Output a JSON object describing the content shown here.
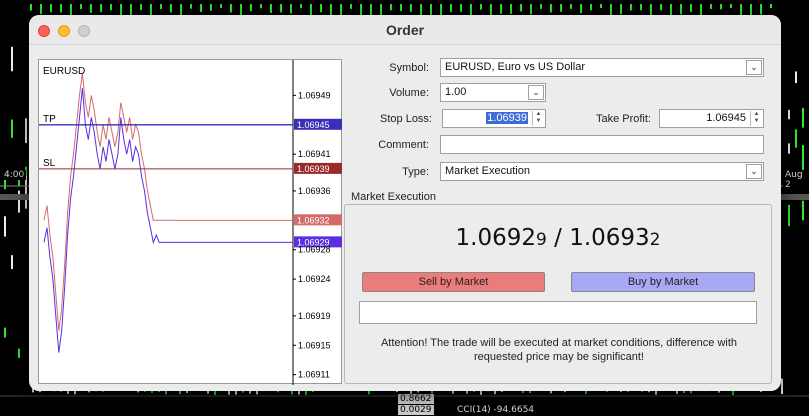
{
  "window": {
    "title": "Order"
  },
  "background": {
    "time_left": "4:00",
    "time_right": "Aug 2",
    "value_1": "0.8662",
    "value_2": "0.0029",
    "indicator": "CCI(14) -94.6654"
  },
  "chart": {
    "symbol": "EURUSD",
    "tp_label": "TP",
    "sl_label": "SL",
    "axis_labels": [
      "1.06949",
      "1.06945",
      "1.06941",
      "1.06939",
      "1.06936",
      "1.06932",
      "1.06929",
      "1.06928",
      "1.06924",
      "1.06919",
      "1.06915",
      "1.06911"
    ],
    "tp_price": "1.06945",
    "sl_price": "1.06939",
    "ask_price": "1.06932",
    "bid_price": "1.06929"
  },
  "chart_data": {
    "type": "line",
    "title": "EURUSD",
    "ylim": [
      1.0691,
      1.06953
    ],
    "series": [
      {
        "values": [
          1.06929,
          1.06931,
          1.06927,
          1.06924,
          1.06919,
          1.06914,
          1.06917,
          1.06923,
          1.0693,
          1.06935,
          1.06938,
          1.06942,
          1.06946,
          1.0695,
          1.06945,
          1.06943,
          1.06946,
          1.06944,
          1.06941,
          1.06939,
          1.06942,
          1.0694,
          1.06943,
          1.06941,
          1.06939,
          1.06941,
          1.06946,
          1.06943,
          1.06941,
          1.06943,
          1.0694,
          1.06942,
          1.06941,
          1.06938,
          1.06936,
          1.06933,
          1.06931,
          1.06929,
          1.0693,
          1.06929,
          1.06929,
          1.06929,
          1.06929,
          1.06929,
          1.06929
        ]
      },
      {
        "values": [
          1.06932,
          1.06934,
          1.0693,
          1.06927,
          1.06922,
          1.06917,
          1.0692,
          1.06926,
          1.06933,
          1.06938,
          1.06941,
          1.06945,
          1.06949,
          1.06952,
          1.06948,
          1.06946,
          1.06949,
          1.06947,
          1.06944,
          1.06942,
          1.06945,
          1.06943,
          1.06946,
          1.06944,
          1.06942,
          1.06944,
          1.06948,
          1.06946,
          1.06944,
          1.06946,
          1.06943,
          1.06945,
          1.06944,
          1.06941,
          1.06939,
          1.06936,
          1.06934,
          1.06932,
          1.06932,
          1.06932,
          1.06932,
          1.06932,
          1.06932,
          1.06932,
          1.06932
        ]
      }
    ]
  },
  "form": {
    "symbol_label": "Symbol:",
    "symbol_value": "EURUSD, Euro vs US Dollar",
    "volume_label": "Volume:",
    "volume_value": "1.00",
    "stoploss_label": "Stop Loss:",
    "stoploss_value": "1.06939",
    "takeprofit_label": "Take Profit:",
    "takeprofit_value": "1.06945",
    "comment_label": "Comment:",
    "comment_value": "",
    "type_label": "Type:",
    "type_value": "Market Execution"
  },
  "execution": {
    "group_title": "Market Execution",
    "bid_main": "1.0692",
    "bid_small": "9",
    "separator": " / ",
    "ask_main": "1.0693",
    "ask_small": "2",
    "sell_label": "Sell by Market",
    "buy_label": "Buy by Market",
    "status_value": "",
    "attention_line1": "Attention! The trade will be executed at market conditions, difference with",
    "attention_line2": "requested price may be significant!"
  },
  "colors": {
    "tp_line": "#3a2fb8",
    "sl_line": "#9b2b2b",
    "bid_line": "#5b2ee0",
    "ask_line": "#d46a6a",
    "sell_button": "#ec7b7b",
    "buy_button": "#a8a8f4"
  }
}
